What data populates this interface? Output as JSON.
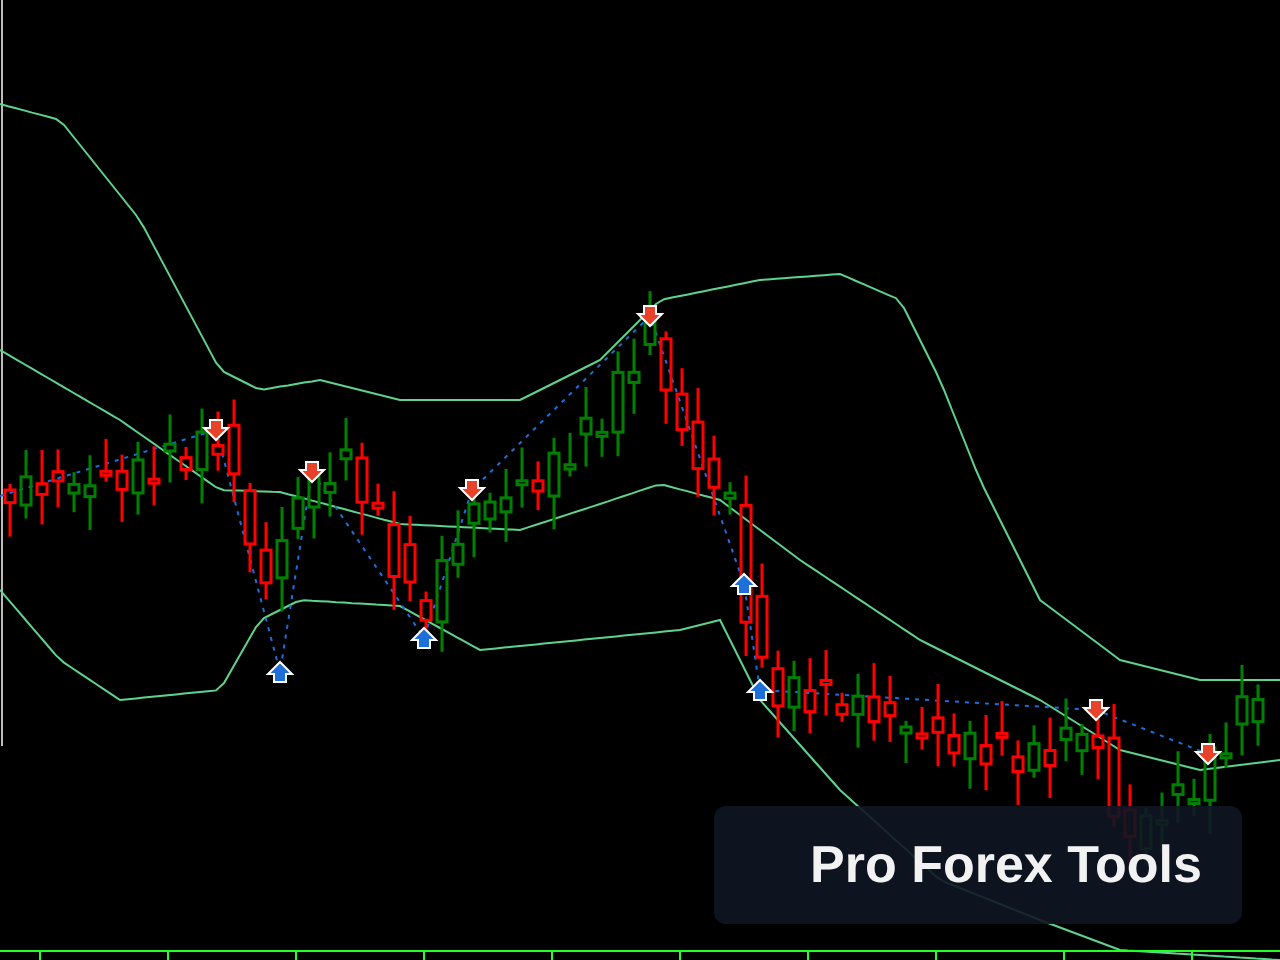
{
  "brand_label": {
    "text": "Pro Forex Tools"
  }
}
